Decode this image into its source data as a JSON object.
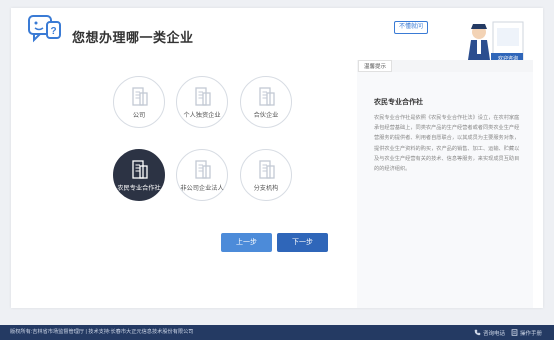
{
  "header": {
    "title": "您想办理哪一类企业"
  },
  "help": {
    "bubble_label": "不懂就问",
    "badge_label": "欢迎咨询"
  },
  "company_types": [
    {
      "label": "公司",
      "selected": false
    },
    {
      "label": "个人独资企业",
      "selected": false
    },
    {
      "label": "合伙企业",
      "selected": false
    },
    {
      "label": "农民专业合作社",
      "selected": true
    },
    {
      "label": "非公司企业法人",
      "selected": false
    },
    {
      "label": "分支机构",
      "selected": false
    }
  ],
  "tip": {
    "tag": "温馨提示",
    "title": "农民专业合作社",
    "body": "农民专业合作社是依照《农民专业合作社法》设立，在农村家庭承包经营基础上，同类农产品的生产经营者或者同类农业生产经营服务的提供者、利用者自愿联合，以其成员为主要服务对象，提供农业生产资料的购买，农产品的销售、加工、运输、贮藏以及与农业生产经营有关的技术、信息等服务，来实现成员互助目的的经济组织。"
  },
  "nav": {
    "prev_label": "上一步",
    "next_label": "下一步"
  },
  "footer": {
    "copyright": "版权所有:吉林省市场监督管理厅 | 技术支持:长春市大正元信息技术股份有限公司",
    "hotline_label": "咨询电话",
    "manual_label": "操作手册"
  },
  "colors": {
    "primary": "#2f66b9",
    "secondary_button": "#4c8bd9",
    "selected_circle": "#2c3344",
    "footer": "#243a63"
  }
}
